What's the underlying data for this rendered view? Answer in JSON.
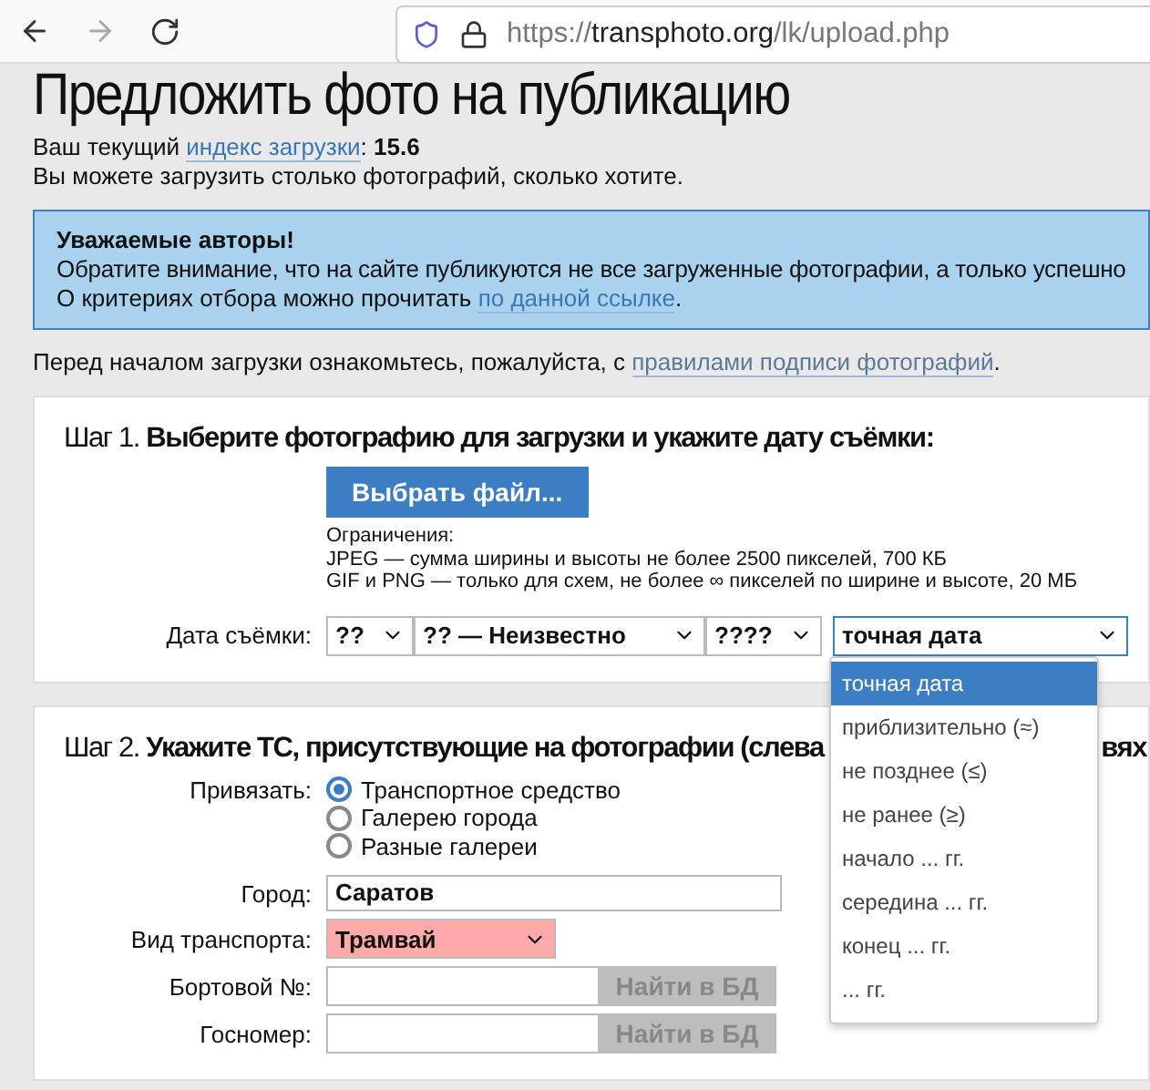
{
  "browser": {
    "url_scheme": "https://",
    "url_host": "transphoto.org",
    "url_path": "/lk/upload.php"
  },
  "page_title": "Предложить фото на публикацию",
  "upload_index": {
    "before": "Ваш текущий ",
    "link": "индекс загрузки",
    "after": ": ",
    "value": "15.6"
  },
  "upload_note": "Вы можете загрузить столько фотографий, сколько хотите.",
  "notice": {
    "heading": "Уважаемые авторы!",
    "line_1": "Обратите внимание, что на сайте публикуются не все загруженные фотографии, а только успешно",
    "line_2_before": "О критериях отбора можно прочитать ",
    "line_2_link": "по данной ссылке",
    "line_2_after": "."
  },
  "rules": {
    "before": "Перед началом загрузки ознакомьтесь, пожалуйста, с ",
    "link": "правилами подписи фотографий",
    "after": "."
  },
  "step_1": {
    "number": "Шаг 1.",
    "title": "Выберите фотографию для загрузки и укажите дату съёмки:",
    "button": "Выбрать файл...",
    "limits": [
      "Ограничения:",
      "JPEG — сумма ширины и высоты не более 2500 пикселей, 700 КБ",
      "GIF и PNG — только для схем, не более ∞ пикселей по ширине и высоте, 20 МБ"
    ],
    "date_label": "Дата съёмки:",
    "date_selects": [
      {
        "value": "??"
      },
      {
        "value": "?? — Неизвестно"
      },
      {
        "value": "????"
      }
    ],
    "precision": {
      "value": "точная дата",
      "expanded": true,
      "options": [
        {
          "label": "точная дата",
          "selected": true
        },
        {
          "label": "приблизительно (≈)",
          "selected": false
        },
        {
          "label": "не позднее (≤)",
          "selected": false
        },
        {
          "label": "не ранее (≥)",
          "selected": false
        },
        {
          "label": "начало ... гг.",
          "selected": false
        },
        {
          "label": "середина ... гг.",
          "selected": false
        },
        {
          "label": "конец ... гг.",
          "selected": false
        },
        {
          "label": "... гг.",
          "selected": false
        }
      ]
    }
  },
  "step_2": {
    "number": "Шаг 2.",
    "title": "Укажите ТС, присутствующие на фотографии (слева",
    "title_tail": "вях",
    "bind_label": "Привязать:",
    "bind_options": [
      {
        "label": "Транспортное средство",
        "selected": true
      },
      {
        "label": "Галерею города",
        "selected": false
      },
      {
        "label": "Разные галереи",
        "selected": false
      }
    ],
    "city_label": "Город:",
    "city_value": "Саратов",
    "transport_label": "Вид транспорта:",
    "transport_value": "Трамвай",
    "fields": [
      {
        "label": "Бортовой №:",
        "button": "Найти в БД",
        "disabled": true
      },
      {
        "label": "Госномер:",
        "button": "Найти в БД",
        "disabled": true
      }
    ]
  }
}
